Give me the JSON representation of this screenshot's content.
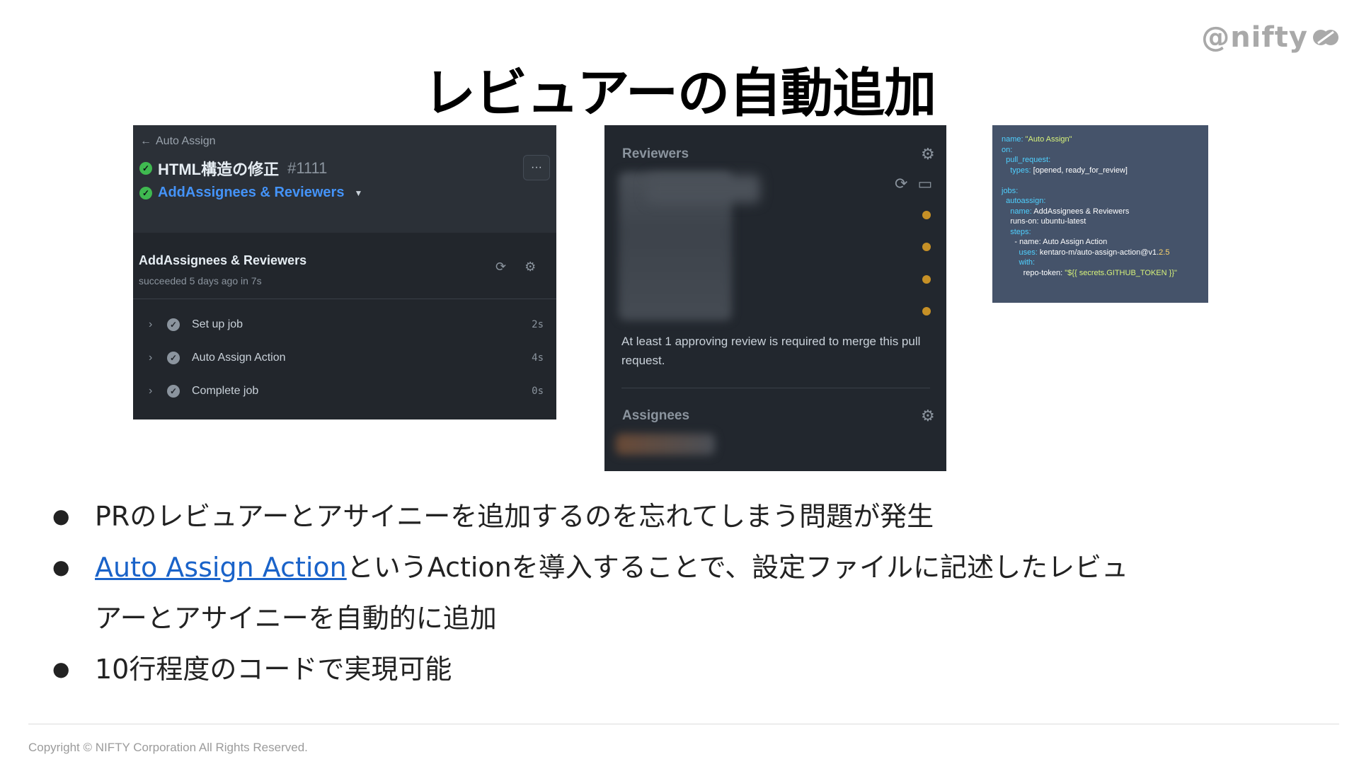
{
  "brand": {
    "logo_text": "@nifty"
  },
  "slide": {
    "title": "レビュアーの自動追加"
  },
  "actions_panel": {
    "back_label": "Auto Assign",
    "pr_title": "HTML構造の修正",
    "pr_number": "#1111",
    "workflow_name": "AddAssignees & Reviewers",
    "more_label": "···",
    "job_title": "AddAssignees & Reviewers",
    "job_status": "succeeded 5 days ago in 7s",
    "steps": [
      {
        "label": "Set up job",
        "duration": "2s"
      },
      {
        "label": "Auto Assign Action",
        "duration": "4s"
      },
      {
        "label": "Complete job",
        "duration": "0s"
      }
    ]
  },
  "reviewers_panel": {
    "reviewers_heading": "Reviewers",
    "message": "At least 1 approving review is required to merge this pull request.",
    "assignees_heading": "Assignees",
    "status_color": "#c69026"
  },
  "yaml_panel": {
    "l1k": "name",
    "l1v": "\"Auto Assign\"",
    "l2k": "on",
    "l3k": "pull_request",
    "l4k": "types",
    "l4v": "[opened, ready_for_review]",
    "l5k": "jobs",
    "l6k": "autoassign",
    "l7k": "name",
    "l7v": "AddAssignees & Reviewers",
    "l8k": "runs-on",
    "l8v": "ubuntu-latest",
    "l9k": "steps",
    "l10k": "- name",
    "l10v": "Auto Assign Action",
    "l11k": "uses",
    "l11v": "kentaro-m/auto-assign-action@v1.",
    "l11n": "2.5",
    "l12k": "with",
    "l13k": "repo-token",
    "l13v": "\"${{ secrets.GITHUB_TOKEN }}\""
  },
  "bullets": {
    "b1": "PRのレビュアーとアサイニーを追加するのを忘れてしまう問題が発生",
    "b2_link": "Auto Assign Action",
    "b2_rest_1": "というActionを導入することで、設定ファイルに記述したレビュ",
    "b2_rest_2": "アーとアサイニーを自動的に追加",
    "b3": "10行程度のコードで実現可能"
  },
  "footer": {
    "copyright": "Copyright © NIFTY Corporation All Rights Reserved."
  }
}
